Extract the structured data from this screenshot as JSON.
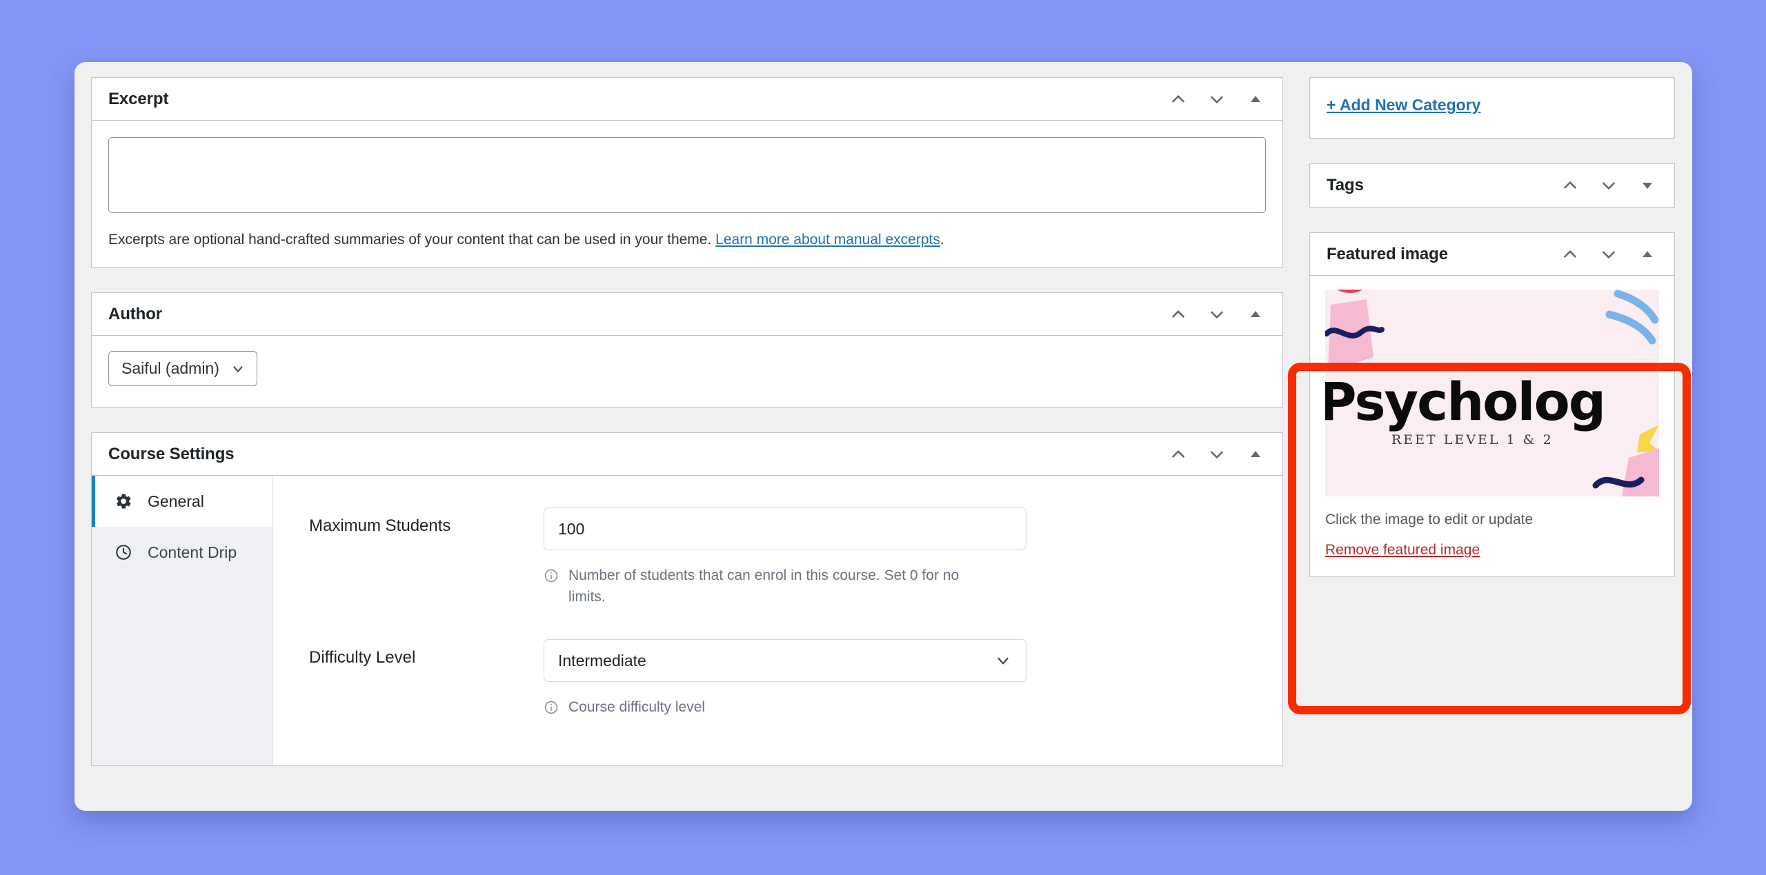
{
  "theme": {
    "page_background": "#8396f5",
    "panel_background": "#f0f0f1",
    "accent_link": "#2271b1",
    "highlight_border": "#f92b00",
    "active_tab_border": "#1e82c4",
    "danger_link": "#b32d2e"
  },
  "main": {
    "excerpt": {
      "title": "Excerpt",
      "textarea_value": "",
      "textarea_placeholder": "",
      "help_text": "Excerpts are optional hand-crafted summaries of your content that can be used in your theme. ",
      "help_link": "Learn more about manual excerpts",
      "help_suffix": ".",
      "controls": [
        "move-up-icon",
        "move-down-icon",
        "toggle-collapse-icon"
      ]
    },
    "author": {
      "title": "Author",
      "selected": "Saiful (admin)",
      "controls": [
        "move-up-icon",
        "move-down-icon",
        "toggle-collapse-icon"
      ]
    },
    "course_settings": {
      "title": "Course Settings",
      "controls": [
        "move-up-icon",
        "move-down-icon",
        "toggle-collapse-icon"
      ],
      "tabs": [
        {
          "label": "General",
          "icon": "gear-icon",
          "active": true
        },
        {
          "label": "Content Drip",
          "icon": "clock-icon",
          "active": false
        }
      ],
      "fields": [
        {
          "label": "Maximum Students",
          "type": "number",
          "value": "100",
          "hint": "Number of students that can enrol in this course. Set 0 for no limits."
        },
        {
          "label": "Difficulty Level",
          "type": "select",
          "value": "Intermediate",
          "hint": "Course difficulty level"
        }
      ]
    }
  },
  "sidebar": {
    "category": {
      "add_new_label": "+ Add New Category"
    },
    "tags": {
      "title": "Tags",
      "controls": [
        "move-up-icon",
        "move-down-icon",
        "toggle-expand-icon"
      ]
    },
    "featured_image": {
      "title": "Featured image",
      "controls": [
        "move-up-icon",
        "move-down-icon",
        "toggle-collapse-icon"
      ],
      "image_alt_word": "Psycholog",
      "image_alt_subtitle": "REET LEVEL 1 & 2",
      "caption": "Click the image to edit or update",
      "remove_label": "Remove featured image",
      "highlighted": true
    }
  }
}
